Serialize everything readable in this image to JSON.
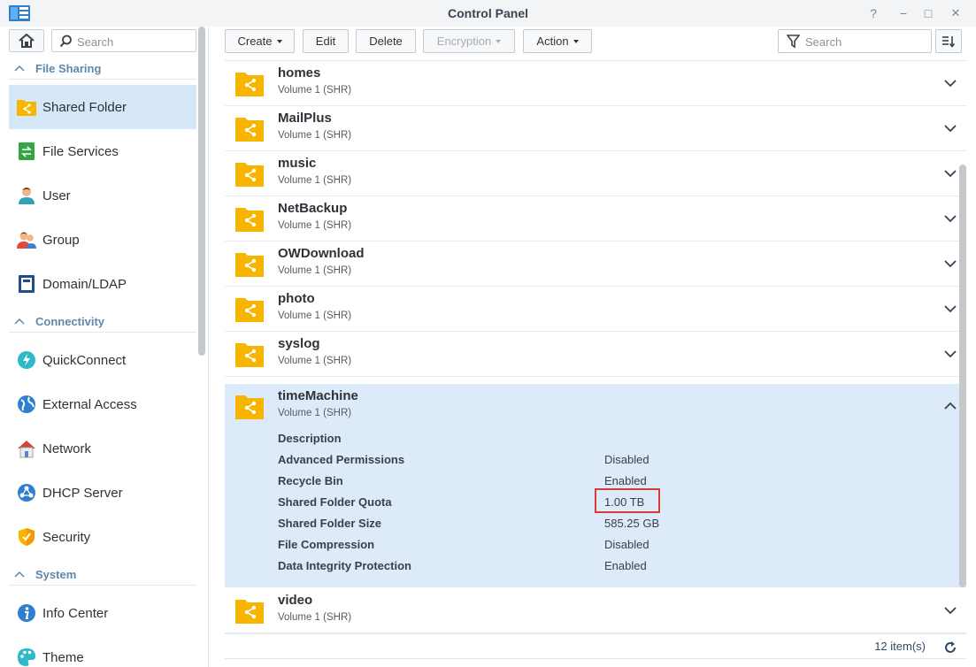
{
  "window": {
    "title": "Control Panel",
    "controls": [
      "?",
      "−",
      "□",
      "×"
    ]
  },
  "sidebar": {
    "search_placeholder": "Search",
    "sections": [
      {
        "title": "File Sharing",
        "items": [
          "Shared Folder",
          "File Services",
          "User",
          "Group",
          "Domain/LDAP"
        ]
      },
      {
        "title": "Connectivity",
        "items": [
          "QuickConnect",
          "External Access",
          "Network",
          "DHCP Server",
          "Security"
        ]
      },
      {
        "title": "System",
        "items": [
          "Info Center",
          "Theme"
        ]
      }
    ],
    "active_item": "Shared Folder"
  },
  "toolbar": {
    "create": "Create",
    "edit": "Edit",
    "delete": "Delete",
    "encryption": "Encryption",
    "action": "Action",
    "filter_placeholder": "Search"
  },
  "folders": [
    {
      "name": "homes",
      "volume": "Volume 1 (SHR)"
    },
    {
      "name": "MailPlus",
      "volume": "Volume 1 (SHR)"
    },
    {
      "name": "music",
      "volume": "Volume 1 (SHR)"
    },
    {
      "name": "NetBackup",
      "volume": "Volume 1 (SHR)"
    },
    {
      "name": "OWDownload",
      "volume": "Volume 1 (SHR)"
    },
    {
      "name": "photo",
      "volume": "Volume 1 (SHR)"
    },
    {
      "name": "syslog",
      "volume": "Volume 1 (SHR)"
    },
    {
      "name": "timeMachine",
      "volume": "Volume 1 (SHR)"
    },
    {
      "name": "video",
      "volume": "Volume 1 (SHR)"
    }
  ],
  "expanded_details": {
    "description_label": "Description",
    "rows": [
      {
        "label": "Advanced Permissions",
        "value": "Disabled"
      },
      {
        "label": "Recycle Bin",
        "value": "Enabled"
      },
      {
        "label": "Shared Folder Quota",
        "value": "1.00 TB"
      },
      {
        "label": "Shared Folder Size",
        "value": "585.25 GB"
      },
      {
        "label": "File Compression",
        "value": "Disabled"
      },
      {
        "label": "Data Integrity Protection",
        "value": "Enabled"
      }
    ]
  },
  "footer": {
    "count": "12 item(s)"
  },
  "colors": {
    "accent": "#d6e7f8",
    "section": "#5d87ab",
    "folder": "#f7b500",
    "highlight": "#d93a3a"
  }
}
